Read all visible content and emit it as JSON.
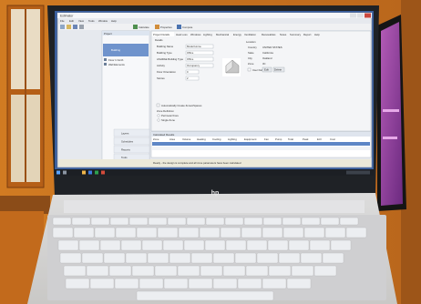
{
  "window": {
    "title": "Estimator",
    "menu": [
      "File",
      "Edit",
      "View",
      "Tools",
      "Window",
      "Help"
    ],
    "toolbar_items": [
      "Calculate",
      "Properties",
      "Compute"
    ]
  },
  "tree": {
    "header": "Project",
    "root": "Building",
    "items": [
      "Floor 1 North",
      "Wall Elements"
    ]
  },
  "left_panel_sections": [
    "Layers",
    "Schedules",
    "Reports",
    "Tools"
  ],
  "dialog": {
    "tabs": [
      "Project Details",
      "Heat Loss",
      "Windows",
      "Lighting",
      "Mechanical",
      "Energy",
      "Ventilation",
      "Renewables",
      "Notes",
      "Summary",
      "Report",
      "Help"
    ],
    "section_title": "Details",
    "fields": [
      {
        "label": "Building Name",
        "value": "Model Home"
      },
      {
        "label": "Building Type",
        "value": "Office"
      },
      {
        "label": "ASHRAE Building Type",
        "value": "Office"
      },
      {
        "label": "Activity",
        "value": "Occupancy"
      },
      {
        "label": "Floor Orientation",
        "value": "0"
      },
      {
        "label": "Stories",
        "value": "2"
      }
    ],
    "location": {
      "title": "Location",
      "rows": [
        {
          "label": "Country",
          "value": "UNITED STATES"
        },
        {
          "label": "State",
          "value": "California"
        },
        {
          "label": "City",
          "value": "Oakland"
        },
        {
          "label": "Zone",
          "value": "3C"
        }
      ],
      "checkbox_label": "User Defined",
      "button_labels": [
        "Edit",
        "Delete"
      ]
    },
    "checkbox_label": "Automatically Create Zones/Spaces",
    "radio_group_title": "Zone Definition",
    "radio_options": [
      "Perimeter/Core",
      "Single Zone"
    ]
  },
  "results": {
    "header": "Calculated Results",
    "columns": [
      "Zone",
      "Area",
      "Volume",
      "Heating",
      "Cooling",
      "Lighting",
      "Equipment",
      "Fan",
      "Pump",
      "Total",
      "Peak",
      "EUI",
      "Cost"
    ]
  },
  "statusbar": {
    "text": "Ready - the design is complete and all zone parameters have been calculated"
  },
  "laptop": {
    "brand_logo": "hp"
  },
  "colors": {
    "wall": "#c7731f",
    "bezel": "#1f2226",
    "desktop_accent": "#3a5f9e",
    "keyboard_deck": "#d9d8d6",
    "keys": "#e9e9ec",
    "side_screen": "#8e3d9a"
  }
}
